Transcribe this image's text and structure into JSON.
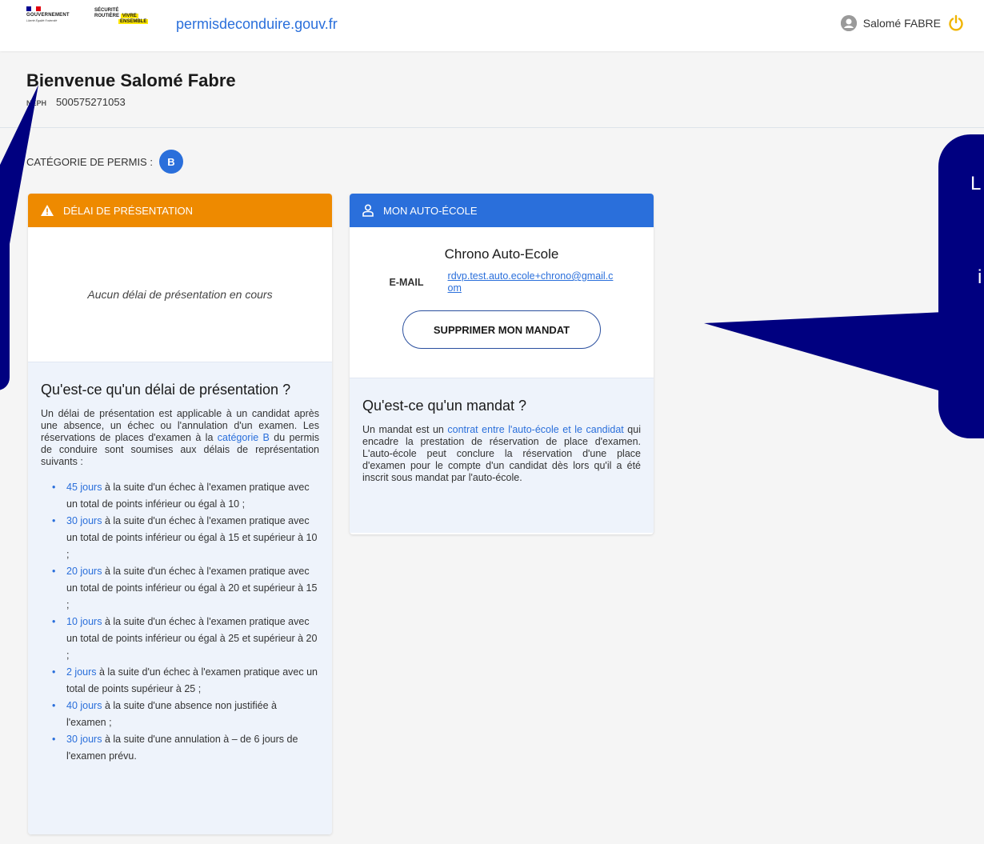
{
  "header": {
    "gov_text": "GOUVERNEMENT",
    "gov_motto": "Liberté Égalité Fraternité",
    "sr_line1": "SÉCURITÉ",
    "sr_line2a": "ROUTIÈRE",
    "sr_line2b": "VIVRE",
    "sr_line3": "ENSEMBLE",
    "site_name_strong": "permisdeconduire",
    "site_name_rest": ".gouv.fr",
    "user_name": "Salomé FABRE"
  },
  "welcome": {
    "title": "Bienvenue Salomé Fabre",
    "neph_label": "NEPH",
    "neph_value": "500575271053"
  },
  "category": {
    "label": "CATÉGORIE DE PERMIS :",
    "value": "B"
  },
  "delai_card": {
    "header": "DÉLAI DE PRÉSENTATION",
    "empty_text": "Aucun délai de présentation en cours",
    "info_title": "Qu'est-ce qu'un délai de présentation ?",
    "intro_before": "Un délai de présentation est applicable à un candidat après une absence, un échec ou l'annulation d'un examen. Les réservations de places d'examen à la ",
    "intro_link": "catégorie B",
    "intro_after": " du permis de conduire sont soumises aux délais de représentation suivants :",
    "items": [
      {
        "days": "45 jours",
        "text": " à la suite d'un échec à l'examen pratique avec un total de points inférieur ou égal à 10 ;"
      },
      {
        "days": "30 jours",
        "text": " à la suite d'un échec à l'examen pratique avec un total de points inférieur ou égal à 15 et supérieur à 10 ;"
      },
      {
        "days": "20 jours",
        "text": " à la suite d'un échec à l'examen pratique avec un total de points inférieur ou égal à 20 et supérieur à 15 ;"
      },
      {
        "days": "10 jours",
        "text": " à la suite d'un échec à l'examen pratique avec un total de points inférieur ou égal à 25 et supérieur à 20 ;"
      },
      {
        "days": "2 jours",
        "text": " à la suite d'un échec à l'examen pratique avec un total de points supérieur à 25 ;"
      },
      {
        "days": "40 jours",
        "text": " à la suite d'une absence non justifiée à l'examen ;"
      },
      {
        "days": "30 jours",
        "text": " à la suite d'une annulation à – de 6 jours de l'examen prévu."
      }
    ]
  },
  "mandat_card": {
    "header": "MON AUTO-ÉCOLE",
    "school_name": "Chrono Auto-Ecole",
    "email_label": "E-MAIL",
    "email_value": "rdvp.test.auto.ecole+chrono@gmail.com",
    "button_label": "SUPPRIMER MON MANDAT",
    "info_title": "Qu'est-ce qu'un mandat ?",
    "para_before": "Un mandat est un ",
    "para_link": "contrat entre l'auto-école et le candidat",
    "para_after": " qui encadre la prestation de réservation de place d'examen. L'auto-école peut conclure la réservation d'une place d'examen pour le compte d'un candidat dès lors qu'il a été inscrit sous mandat par l'auto-école."
  },
  "callout": {
    "right_text1": "L",
    "right_text2": "i"
  },
  "colors": {
    "primary_blue": "#2a6fdb",
    "warning_orange": "#ee8a00",
    "callout_navy": "#000080"
  }
}
